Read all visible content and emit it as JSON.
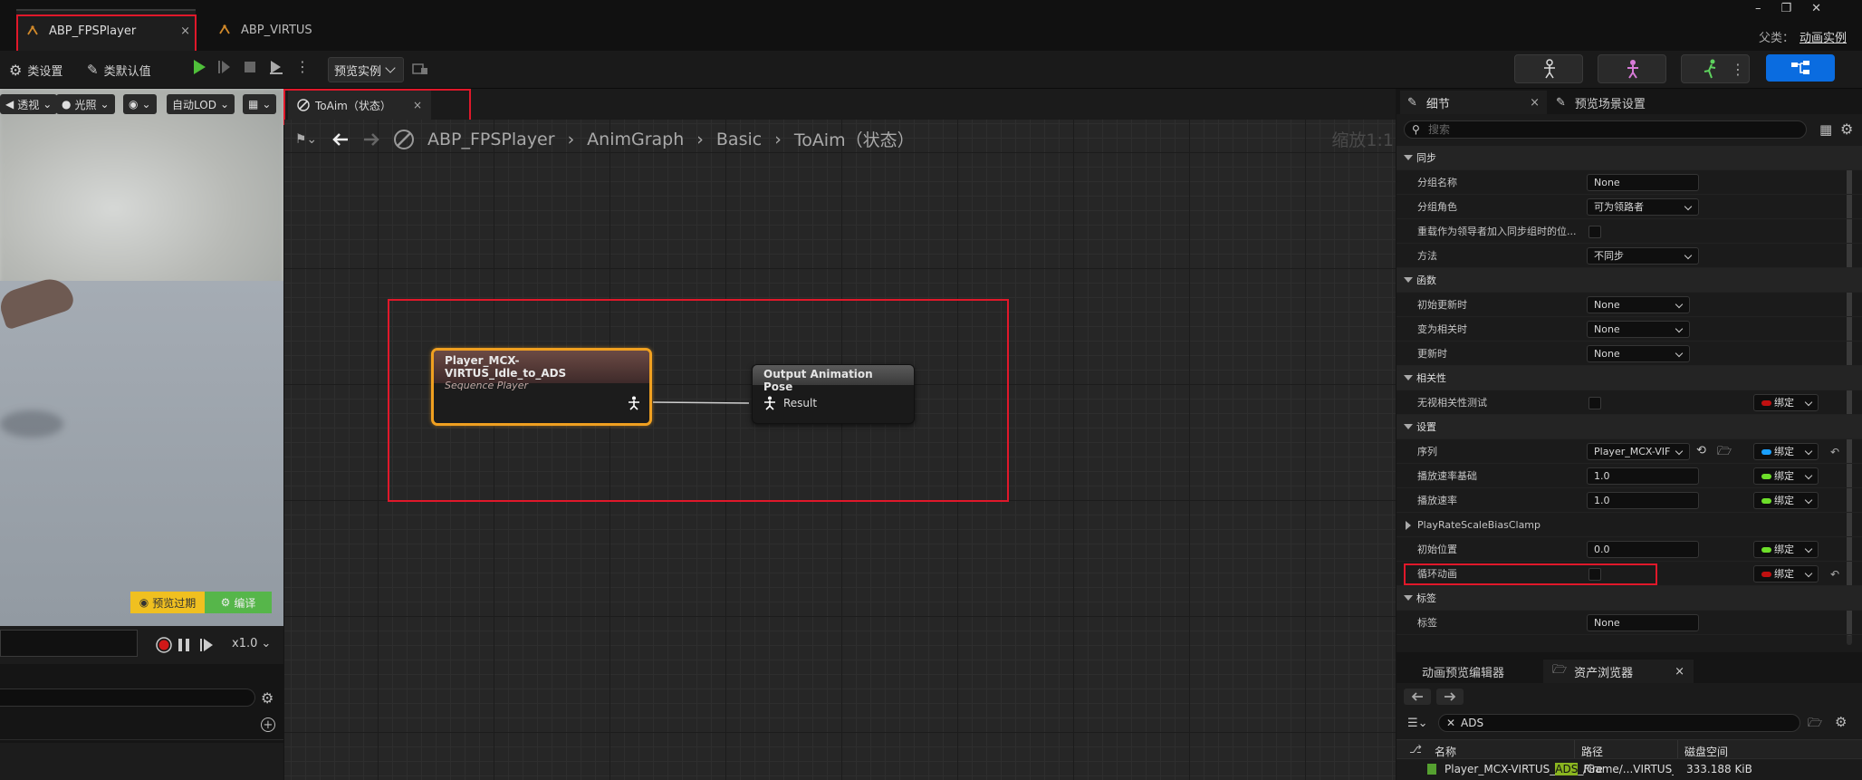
{
  "tabs": [
    {
      "label": "ABP_FPSPlayer"
    },
    {
      "label": "ABP_VIRTUS"
    }
  ],
  "titlebar": {
    "parent_label": "父类：",
    "parent_value": "动画实例",
    "window_buttons": [
      "minimize-icon",
      "restore-icon",
      "close-icon"
    ]
  },
  "toolbar": {
    "class_settings": "类设置",
    "class_defaults": "类默认值",
    "preview_instance": "预览实例",
    "mode_icons": [
      "skeleton-mode-icon",
      "mesh-mode-icon",
      "animation-mode-icon",
      "blueprint-mode-icon"
    ],
    "accent": "#0a6ce0"
  },
  "viewport": {
    "perspective": "透视",
    "lighting": "光照",
    "lod": "自动LOD",
    "preview_mode": "预览过期",
    "compile": "编译",
    "speed": "x1.0"
  },
  "graph_tab": {
    "label": "ToAim（状态）"
  },
  "breadcrumb": {
    "items": [
      "ABP_FPSPlayer",
      "AnimGraph",
      "Basic",
      "ToAim（状态）"
    ],
    "zoom": "缩放1:1"
  },
  "nodes": {
    "sequence": {
      "title": "Player_MCX-VIRTUS_Idle_to_ADS",
      "subtitle": "Sequence Player",
      "color": "#f0a020"
    },
    "output": {
      "title": "Output Animation Pose",
      "pin": "Result"
    }
  },
  "details": {
    "tab_details": "细节",
    "tab_preview": "预览场景设置",
    "search_placeholder": "搜索",
    "sections": {
      "sync": "同步",
      "functions": "函数",
      "relevancy": "相关性",
      "settings": "设置",
      "tags": "标签"
    },
    "rows": {
      "group_name": {
        "label": "分组名称",
        "value": "None"
      },
      "group_role": {
        "label": "分组角色",
        "value": "可为领路者"
      },
      "override_leader": {
        "label": "重载作为领导者加入同步组时的位..."
      },
      "method": {
        "label": "方法",
        "value": "不同步"
      },
      "initial_update": {
        "label": "初始更新时",
        "value": "None"
      },
      "become_relevant": {
        "label": "变为相关时",
        "value": "None"
      },
      "on_update": {
        "label": "更新时",
        "value": "None"
      },
      "ignore_relevancy": {
        "label": "无视相关性测试"
      },
      "sequence": {
        "label": "序列",
        "value": "Player_MCX-VIF"
      },
      "play_rate_basis": {
        "label": "播放速率基础",
        "value": "1.0"
      },
      "play_rate": {
        "label": "播放速率",
        "value": "1.0"
      },
      "bias_clamp": {
        "label": "PlayRateScaleBiasClamp"
      },
      "start_position": {
        "label": "初始位置",
        "value": "0.0"
      },
      "loop": {
        "label": "循环动画"
      },
      "tag": {
        "label": "标签",
        "value": "None"
      }
    },
    "bind_label": "绑定",
    "bind_colors": {
      "bool": "#c01010",
      "object": "#1aa0ff",
      "float": "#6dde2a"
    }
  },
  "bottom_panel": {
    "tab_preview_editor": "动画预览编辑器",
    "tab_asset_browser": "资产浏览器",
    "search_value": "ADS",
    "columns": [
      "名称",
      "路径",
      "磁盘空间"
    ],
    "rows": [
      {
        "name_pre": "Player_MCX-VIRTUS_",
        "name_hl": "ADS",
        "name_post": "_Fire",
        "path": "/Game/...VIRTUS_",
        "size": "333.188 KiB"
      }
    ]
  }
}
